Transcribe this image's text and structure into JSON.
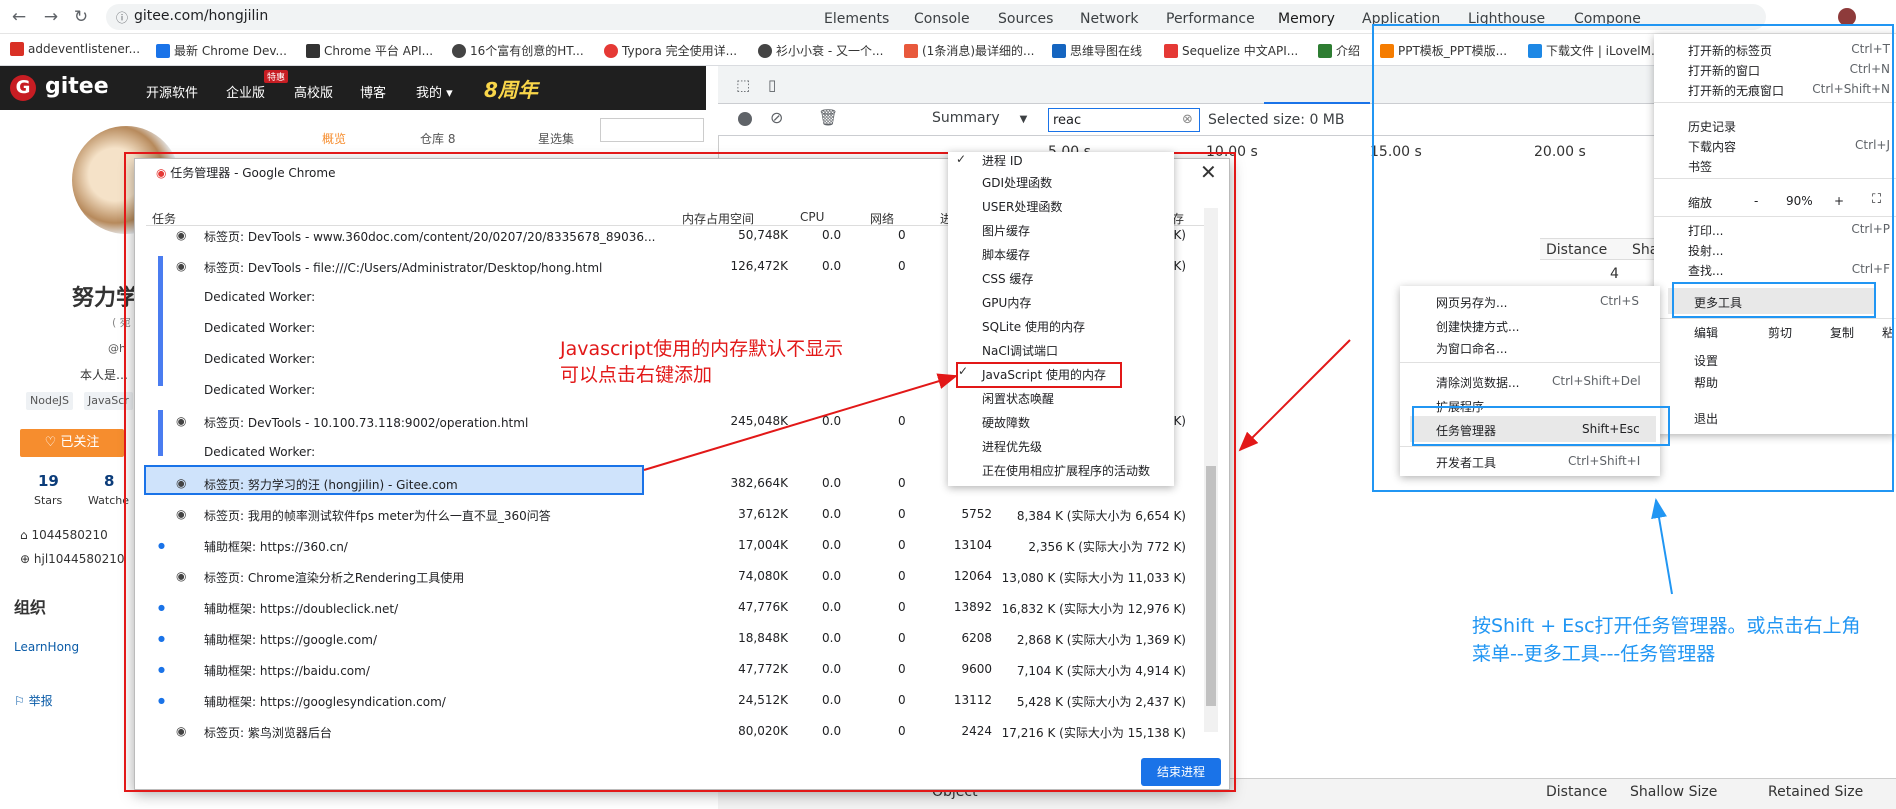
{
  "toolbar": {
    "url": "gitee.com/hongjilin",
    "back": "←",
    "forward": "→",
    "reload": "↻",
    "lock": "ⓘ"
  },
  "bookmarks": [
    {
      "label": "addeventlistener...",
      "color": "#d93025"
    },
    {
      "label": "最新 Chrome Dev...",
      "color": "#1a73e8"
    },
    {
      "label": "Chrome 平台 API...",
      "color": "#333333"
    },
    {
      "label": "16个富有创意的HT...",
      "color": "#444444"
    },
    {
      "label": "Typora 完全使用详...",
      "color": "#e53935"
    },
    {
      "label": "衫小小衰 - 又一个...",
      "color": "#444444"
    },
    {
      "label": "(1条消息)最详细的...",
      "color": "#e8593c"
    },
    {
      "label": "思维导图在线",
      "color": "#1565c0"
    },
    {
      "label": "Sequelize 中文API...",
      "color": "#e53935"
    },
    {
      "label": "介绍",
      "color": "#2e7d32"
    },
    {
      "label": "PPT模板_PPT模版...",
      "color": "#f57c00"
    },
    {
      "label": "下载文件 | iLovelM...",
      "color": "#1e88e5"
    }
  ],
  "gitee": {
    "logo_letter": "G",
    "logo": "gitee",
    "nav": [
      "开源软件",
      "企业版",
      "高校版",
      "博客",
      "我的 ▾"
    ],
    "hot_badge": "特惠",
    "anniversary": "8周年",
    "tabs": [
      "概览",
      "仓库 8",
      "星选集"
    ],
    "name": "努力学",
    "paren": "( 宛",
    "at": "@h",
    "bio": "本人是…",
    "tags": [
      "NodeJS",
      "JavaScr"
    ],
    "follow": "♡ 已关注",
    "stats": [
      {
        "num": "19",
        "label": "Stars"
      },
      {
        "num": "8",
        "label": "Watche"
      }
    ],
    "qq": "1044580210",
    "wx": "hjl1044580210",
    "org": "组织",
    "org_item": "LearnHong",
    "report": "举报"
  },
  "devtools": {
    "tabs": [
      "Elements",
      "Console",
      "Sources",
      "Network",
      "Performance",
      "Memory",
      "Application",
      "Lighthouse",
      "Compone"
    ],
    "summary": "Summary",
    "filter": "reac",
    "selected": "Selected size: 0 MB",
    "timeline": [
      "5.00 s",
      "10.00 s",
      "15.00 s",
      "20.00 s"
    ],
    "cols_top": [
      "Distance",
      "Sha"
    ],
    "dist_val": "4",
    "bottom_cols": [
      "Object",
      "Distance",
      "Shallow Size",
      "Retained Size"
    ]
  },
  "chrome_menu": {
    "items": [
      {
        "label": "打开新的标签页",
        "sc": "Ctrl+T"
      },
      {
        "label": "打开新的窗口",
        "sc": "Ctrl+N"
      },
      {
        "label": "打开新的无痕窗口",
        "sc": "Ctrl+Shift+N"
      },
      {
        "label": "历史记录",
        "sc": ""
      },
      {
        "label": "下载内容",
        "sc": "Ctrl+J"
      },
      {
        "label": "书签",
        "sc": ""
      },
      {
        "label": "打印...",
        "sc": "Ctrl+P"
      },
      {
        "label": "投射...",
        "sc": ""
      },
      {
        "label": "查找...",
        "sc": "Ctrl+F"
      },
      {
        "label": "更多工具",
        "sc": ""
      },
      {
        "label": "设置",
        "sc": ""
      },
      {
        "label": "帮助",
        "sc": ""
      },
      {
        "label": "退出",
        "sc": ""
      }
    ],
    "zoom_label": "缩放",
    "zoom_minus": "-",
    "zoom_value": "90%",
    "zoom_plus": "+",
    "edit_label": "编辑",
    "cut": "剪切",
    "copy": "复制",
    "paste": "粘"
  },
  "submenu": {
    "items": [
      {
        "label": "网页另存为...",
        "sc": "Ctrl+S"
      },
      {
        "label": "创建快捷方式...",
        "sc": ""
      },
      {
        "label": "为窗口命名...",
        "sc": ""
      },
      {
        "label": "清除浏览数据...",
        "sc": "Ctrl+Shift+Del"
      },
      {
        "label": "扩展程序",
        "sc": ""
      },
      {
        "label": "任务管理器",
        "sc": "Shift+Esc"
      },
      {
        "label": "开发者工具",
        "sc": "Ctrl+Shift+I"
      }
    ]
  },
  "task_manager": {
    "title": "任务管理器 - Google Chrome",
    "headers": [
      "任务",
      "内存占用空间",
      "CPU",
      "网络",
      "进",
      "存"
    ],
    "end_button": "结束进程",
    "rows": [
      {
        "task": "标签页: DevTools - www.360doc.com/content/20/0207/20/8335678_89036...",
        "mem": "50,748K",
        "cpu": "0.0",
        "net": "0",
        "pid": "",
        "js": "K)"
      },
      {
        "task": "标签页: DevTools - file:///C:/Users/Administrator/Desktop/hong.html",
        "mem": "126,472K",
        "cpu": "0.0",
        "net": "0",
        "pid": "",
        "js": "4 K)"
      },
      {
        "task": "Dedicated Worker:",
        "mem": "",
        "cpu": "",
        "net": "",
        "pid": "",
        "js": ""
      },
      {
        "task": "Dedicated Worker:",
        "mem": "",
        "cpu": "",
        "net": "",
        "pid": "",
        "js": ""
      },
      {
        "task": "Dedicated Worker:",
        "mem": "",
        "cpu": "",
        "net": "",
        "pid": "",
        "js": ""
      },
      {
        "task": "Dedicated Worker:",
        "mem": "",
        "cpu": "",
        "net": "",
        "pid": "",
        "js": ""
      },
      {
        "task": "标签页: DevTools - 10.100.73.118:9002/operation.html",
        "mem": "245,048K",
        "cpu": "0.0",
        "net": "0",
        "pid": "",
        "js": "K)"
      },
      {
        "task": "Dedicated Worker:",
        "mem": "",
        "cpu": "",
        "net": "",
        "pid": "",
        "js": ""
      },
      {
        "task": "标签页: 努力学习的汪 (hongjilin) - Gitee.com",
        "mem": "382,664K",
        "cpu": "0.0",
        "net": "0",
        "pid": "",
        "js": ""
      },
      {
        "task": "标签页: 我用的帧率测试软件fps meter为什么一直不显_360问答",
        "mem": "37,612K",
        "cpu": "0.0",
        "net": "0",
        "pid": "5752",
        "js": "8,384 K (实际大小为 6,654 K)"
      },
      {
        "task": "辅助框架: https://360.cn/",
        "mem": "17,004K",
        "cpu": "0.0",
        "net": "0",
        "pid": "13104",
        "js": "2,356 K (实际大小为 772 K)"
      },
      {
        "task": "标签页: Chrome渲染分析之Rendering工具使用",
        "mem": "74,080K",
        "cpu": "0.0",
        "net": "0",
        "pid": "12064",
        "js": "13,080 K (实际大小为 11,033 K)"
      },
      {
        "task": "辅助框架: https://doubleclick.net/",
        "mem": "47,776K",
        "cpu": "0.0",
        "net": "0",
        "pid": "13892",
        "js": "16,832 K (实际大小为 12,976 K)"
      },
      {
        "task": "辅助框架: https://google.com/",
        "mem": "18,848K",
        "cpu": "0.0",
        "net": "0",
        "pid": "6208",
        "js": "2,868 K (实际大小为 1,369 K)"
      },
      {
        "task": "辅助框架: https://baidu.com/",
        "mem": "47,772K",
        "cpu": "0.0",
        "net": "0",
        "pid": "9600",
        "js": "7,104 K (实际大小为 4,914 K)"
      },
      {
        "task": "辅助框架: https://googlesyndication.com/",
        "mem": "24,512K",
        "cpu": "0.0",
        "net": "0",
        "pid": "13112",
        "js": "5,428 K (实际大小为 2,437 K)"
      },
      {
        "task": "标签页: 紫鸟浏览器后台",
        "mem": "80,020K",
        "cpu": "0.0",
        "net": "0",
        "pid": "2424",
        "js": "17,216 K (实际大小为 15,138 K)"
      }
    ]
  },
  "context_menu": {
    "items": [
      "进程 ID",
      "GDI处理函数",
      "USER处理函数",
      "图片缓存",
      "脚本缓存",
      "CSS 缓存",
      "GPU内存",
      "SQLite 使用的内存",
      "NaCl调试端口",
      "JavaScript 使用的内存",
      "闲置状态唤醒",
      "硬故障数",
      "进程优先级",
      "正在使用相应扩展程序的活动数"
    ],
    "checked": "✓"
  },
  "annotations": {
    "red_line1": "Javascript使用的内存默认不显示",
    "red_line2": "可以点击右键添加",
    "blue_line1": "按Shift + Esc打开任务管理器。或点击右上角",
    "blue_line2": "菜单--更多工具---任务管理器"
  },
  "colors": {
    "annotation_red": "#e21818",
    "annotation_blue": "#2196f3",
    "gitee_red": "#c71d23",
    "follow_orange": "#f68d2e"
  }
}
